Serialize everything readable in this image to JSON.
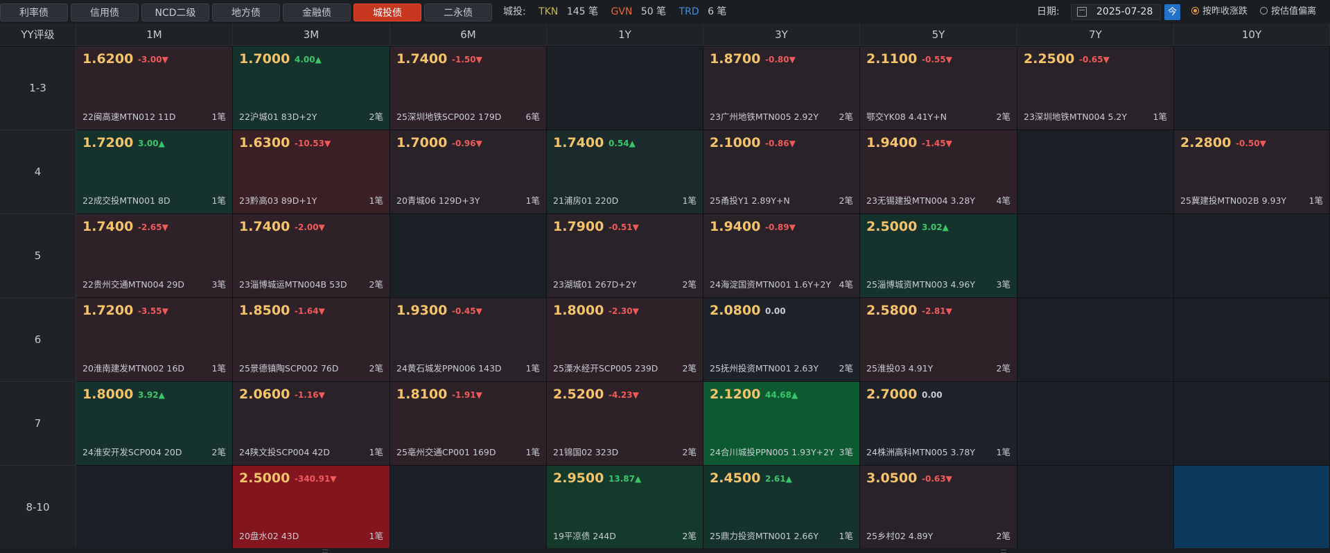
{
  "tabs": [
    {
      "label": "利率债",
      "active": false
    },
    {
      "label": "信用债",
      "active": false
    },
    {
      "label": "NCD二级",
      "active": false
    },
    {
      "label": "地方债",
      "active": false
    },
    {
      "label": "金融债",
      "active": false
    },
    {
      "label": "城投债",
      "active": true
    },
    {
      "label": "二永债",
      "active": false
    }
  ],
  "counts": {
    "label": "城投:",
    "tkn_tag": "TKN",
    "tkn_value": "145 笔",
    "gvn_tag": "GVN",
    "gvn_value": "50 笔",
    "trd_tag": "TRD",
    "trd_value": "6 笔",
    "colors": {
      "tkn": "#c9b843",
      "gvn": "#e8663a",
      "trd": "#3f8fe0"
    }
  },
  "date": {
    "label": "日期:",
    "value": "2025-07-28",
    "today_label": "今",
    "icon": "calendar-icon"
  },
  "radios": [
    {
      "label": "按昨收涨跌",
      "checked": true
    },
    {
      "label": "按估值偏离",
      "checked": false
    }
  ],
  "grid": {
    "corner": "YY评级",
    "columns": [
      "1M",
      "3M",
      "6M",
      "1Y",
      "3Y",
      "5Y",
      "7Y",
      "10Y"
    ],
    "rows": [
      {
        "label": "1-3",
        "cells": [
          {
            "yield": "1.6200",
            "change": "-3.00▼",
            "dir": "down",
            "bond": "22闽高速MTN012 11D",
            "count": "1笔",
            "bg": "#2e2228"
          },
          {
            "yield": "1.7000",
            "change": "4.00▲",
            "dir": "up",
            "bond": "22沪城01 83D+2Y",
            "count": "2笔",
            "bg": "#16322d"
          },
          {
            "yield": "1.7400",
            "change": "-1.50▼",
            "dir": "down",
            "bond": "25深圳地铁SCP002 179D",
            "count": "6笔",
            "bg": "#2e2228"
          },
          null,
          {
            "yield": "1.8700",
            "change": "-0.80▼",
            "dir": "down",
            "bond": "23广州地铁MTN005 2.92Y",
            "count": "2笔",
            "bg": "#2a2229"
          },
          {
            "yield": "2.1100",
            "change": "-0.55▼",
            "dir": "down",
            "bond": "鄂交YK08 4.41Y+N",
            "count": "2笔",
            "bg": "#2a2229"
          },
          {
            "yield": "2.2500",
            "change": "-0.65▼",
            "dir": "down",
            "bond": "23深圳地铁MTN004 5.2Y",
            "count": "1笔",
            "bg": "#2a2229"
          },
          null
        ]
      },
      {
        "label": "4",
        "cells": [
          {
            "yield": "1.7200",
            "change": "3.00▲",
            "dir": "up",
            "bond": "22成交投MTN001 8D",
            "count": "1笔",
            "bg": "#16322d"
          },
          {
            "yield": "1.6300",
            "change": "-10.53▼",
            "dir": "down",
            "bond": "23黔高03 89D+1Y",
            "count": "1笔",
            "bg": "#3a1f25"
          },
          {
            "yield": "1.7000",
            "change": "-0.96▼",
            "dir": "down",
            "bond": "20青城06 129D+3Y",
            "count": "1笔",
            "bg": "#2a2229"
          },
          {
            "yield": "1.7400",
            "change": "0.54▲",
            "dir": "up",
            "bond": "21浦房01 220D",
            "count": "1笔",
            "bg": "#1b2b2b"
          },
          {
            "yield": "2.1000",
            "change": "-0.86▼",
            "dir": "down",
            "bond": "25甬投Y1 2.89Y+N",
            "count": "2笔",
            "bg": "#2a2229"
          },
          {
            "yield": "1.9400",
            "change": "-1.45▼",
            "dir": "down",
            "bond": "23无锡建投MTN004 3.28Y",
            "count": "4笔",
            "bg": "#2e2228"
          },
          null,
          {
            "yield": "2.2800",
            "change": "-0.50▼",
            "dir": "down",
            "bond": "25冀建投MTN002B 9.93Y",
            "count": "1笔",
            "bg": "#2a2229"
          }
        ]
      },
      {
        "label": "5",
        "cells": [
          {
            "yield": "1.7400",
            "change": "-2.65▼",
            "dir": "down",
            "bond": "22贵州交通MTN004 29D",
            "count": "3笔",
            "bg": "#2e2228"
          },
          {
            "yield": "1.7400",
            "change": "-2.00▼",
            "dir": "down",
            "bond": "23淄博城运MTN004B 53D",
            "count": "2笔",
            "bg": "#2e2228"
          },
          null,
          {
            "yield": "1.7900",
            "change": "-0.51▼",
            "dir": "down",
            "bond": "23湖城01 267D+2Y",
            "count": "2笔",
            "bg": "#2a2229"
          },
          {
            "yield": "1.9400",
            "change": "-0.89▼",
            "dir": "down",
            "bond": "24海淀国资MTN001 1.6Y+2Y",
            "count": "4笔",
            "bg": "#2a2229"
          },
          {
            "yield": "2.5000",
            "change": "3.02▲",
            "dir": "up",
            "bond": "25淄博城资MTN003 4.96Y",
            "count": "3笔",
            "bg": "#16322d"
          },
          null,
          null
        ]
      },
      {
        "label": "6",
        "cells": [
          {
            "yield": "1.7200",
            "change": "-3.55▼",
            "dir": "down",
            "bond": "20淮南建发MTN002 16D",
            "count": "1笔",
            "bg": "#2e2228"
          },
          {
            "yield": "1.8500",
            "change": "-1.64▼",
            "dir": "down",
            "bond": "25景德镇陶SCP002 76D",
            "count": "2笔",
            "bg": "#2e2228"
          },
          {
            "yield": "1.9300",
            "change": "-0.45▼",
            "dir": "down",
            "bond": "24黄石城发PPN006 143D",
            "count": "1笔",
            "bg": "#2a2229"
          },
          {
            "yield": "1.8000",
            "change": "-2.30▼",
            "dir": "down",
            "bond": "25溧水经开SCP005 239D",
            "count": "2笔",
            "bg": "#2e2228"
          },
          {
            "yield": "2.0800",
            "change": "0.00",
            "dir": "flat",
            "bond": "25抚州投资MTN001 2.63Y",
            "count": "2笔",
            "bg": "#1e232a"
          },
          {
            "yield": "2.5800",
            "change": "-2.81▼",
            "dir": "down",
            "bond": "25淮投03 4.91Y",
            "count": "2笔",
            "bg": "#2e2228"
          },
          null,
          null
        ]
      },
      {
        "label": "7",
        "cells": [
          {
            "yield": "1.8000",
            "change": "3.92▲",
            "dir": "up",
            "bond": "24淮安开发SCP004 20D",
            "count": "2笔",
            "bg": "#16322d"
          },
          {
            "yield": "2.0600",
            "change": "-1.16▼",
            "dir": "down",
            "bond": "24陕文投SCP004 42D",
            "count": "1笔",
            "bg": "#2a2229"
          },
          {
            "yield": "1.8100",
            "change": "-1.91▼",
            "dir": "down",
            "bond": "25亳州交通CP001 169D",
            "count": "1笔",
            "bg": "#2e2228"
          },
          {
            "yield": "2.5200",
            "change": "-4.23▼",
            "dir": "down",
            "bond": "21锦国02 323D",
            "count": "2笔",
            "bg": "#2e2228"
          },
          {
            "yield": "2.1200",
            "change": "44.68▲",
            "dir": "up",
            "bond": "24合川城投PPN005 1.93Y+2Y",
            "count": "3笔",
            "bg": "#0d5a32"
          },
          {
            "yield": "2.7000",
            "change": "0.00",
            "dir": "flat",
            "bond": "24株洲高科MTN005 3.78Y",
            "count": "1笔",
            "bg": "#1e232a"
          },
          null,
          null
        ]
      },
      {
        "label": "8-10",
        "cells": [
          null,
          {
            "yield": "2.5000",
            "change": "-340.91▼",
            "dir": "down",
            "bond": "20盘水02 43D",
            "count": "1笔",
            "bg": "#83151f"
          },
          null,
          {
            "yield": "2.9500",
            "change": "13.87▲",
            "dir": "up",
            "bond": "19平凉债 244D",
            "count": "2笔",
            "bg": "#143a2c"
          },
          {
            "yield": "2.4500",
            "change": "2.61▲",
            "dir": "up",
            "bond": "25鼎力投资MTN001 2.66Y",
            "count": "1笔",
            "bg": "#16322d"
          },
          {
            "yield": "3.0500",
            "change": "-0.63▼",
            "dir": "down",
            "bond": "25乡村02 4.89Y",
            "count": "2笔",
            "bg": "#2a2229"
          },
          null,
          {
            "highlight": true,
            "bg": "#0b3a5e"
          }
        ]
      }
    ]
  },
  "empty_cell_bg": "#1b1f26"
}
